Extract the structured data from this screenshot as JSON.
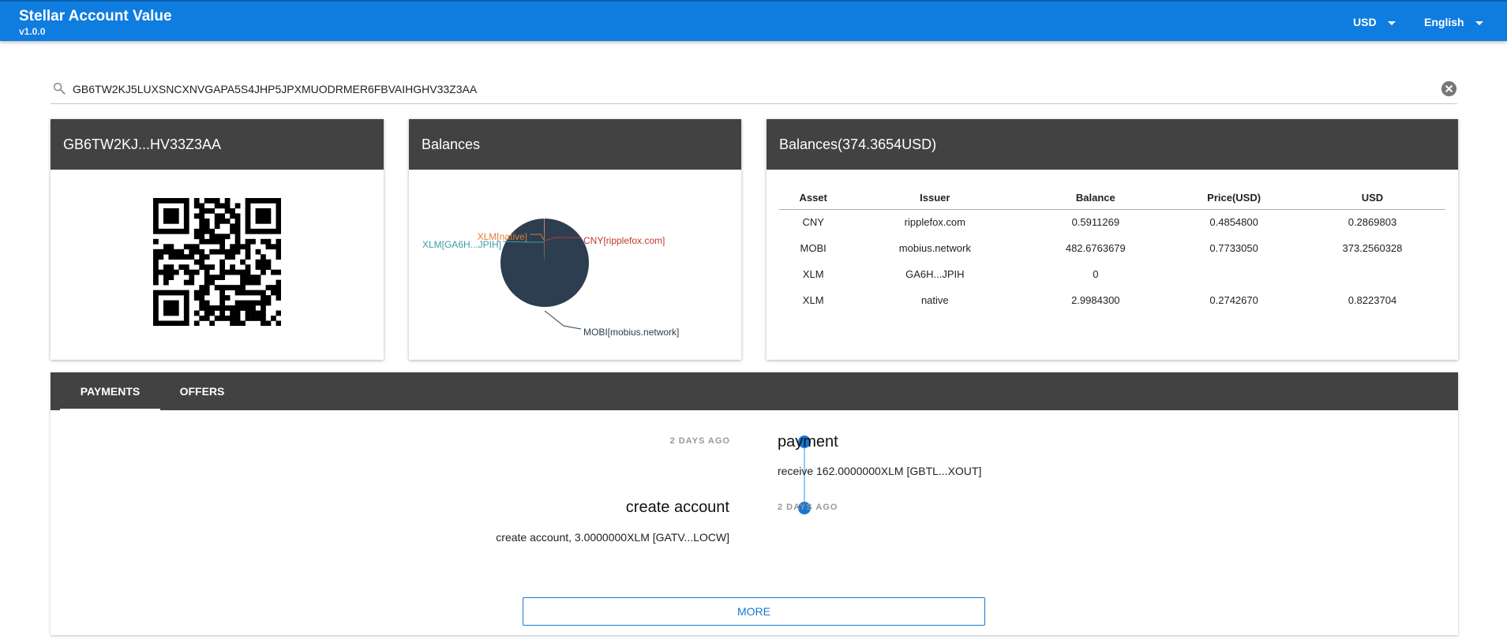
{
  "app": {
    "title": "Stellar Account Value",
    "version": "v1.0.0",
    "currency": "USD",
    "language": "English"
  },
  "search": {
    "value": "GB6TW2KJ5LUXSNCXNVGAPA5S4JHP5JPXMUODRMER6FBVAIHGHV33Z3AA",
    "icon": "search-icon",
    "clear_icon": "clear-icon"
  },
  "account_card": {
    "title": "GB6TW2KJ...HV33Z3AA"
  },
  "pie_card": {
    "title": "Balances"
  },
  "chart_data": {
    "type": "pie",
    "title": "Balances",
    "slices": [
      {
        "label": "MOBI[mobius.network]",
        "value": 373.2560328,
        "color": "#2c3e50"
      },
      {
        "label": "XLM[native]",
        "value": 0.8223704,
        "color": "#e07b39"
      },
      {
        "label": "CNY[ripplefox.com]",
        "value": 0.2869803,
        "color": "#c0392b"
      },
      {
        "label": "XLM[GA6H...JPIH]",
        "value": 0,
        "color": "#3a9fa6"
      }
    ]
  },
  "balances_card": {
    "title": "Balances(374.3654USD)",
    "columns": [
      "Asset",
      "Issuer",
      "Balance",
      "Price(USD)",
      "USD"
    ],
    "rows": [
      [
        "CNY",
        "ripplefox.com",
        "0.5911269",
        "0.4854800",
        "0.2869803"
      ],
      [
        "MOBI",
        "mobius.network",
        "482.6763679",
        "0.7733050",
        "373.2560328"
      ],
      [
        "XLM",
        "GA6H...JPIH",
        "0",
        "",
        ""
      ],
      [
        "XLM",
        "native",
        "2.9984300",
        "0.2742670",
        "0.8223704"
      ]
    ]
  },
  "tabs": [
    {
      "label": "PAYMENTS",
      "active": true
    },
    {
      "label": "OFFERS",
      "active": false
    }
  ],
  "timeline": [
    {
      "time": "2 DAYS AGO",
      "title": "payment",
      "body": "receive 162.0000000XLM [GBTL...XOUT]"
    },
    {
      "time": "2 DAYS AGO",
      "title": "create account",
      "body": "create account, 3.0000000XLM [GATV...LOCW]"
    }
  ],
  "more_label": "MORE",
  "colors": {
    "appbar": "#0f7ddf",
    "card_header": "#424242",
    "accent": "#1976d2"
  }
}
